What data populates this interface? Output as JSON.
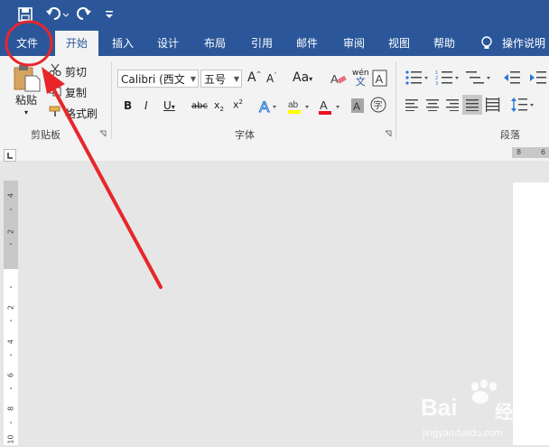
{
  "tabs": [
    "文件",
    "开始",
    "插入",
    "设计",
    "布局",
    "引用",
    "邮件",
    "审阅",
    "视图",
    "帮助"
  ],
  "tell_me": "操作说明",
  "clipboard": {
    "paste": "粘贴",
    "cut": "剪切",
    "copy": "复制",
    "format_painter": "格式刷",
    "group": "剪贴板"
  },
  "font": {
    "name": "Calibri (西文",
    "size": "五号",
    "group": "字体"
  },
  "paragraph": {
    "group": "段落"
  },
  "ruler": {
    "h_numbers": [
      "8",
      "6"
    ],
    "v_numbers": [
      "4",
      "2",
      "2",
      "4",
      "6",
      "8",
      "10"
    ]
  },
  "watermark": {
    "brand": "Bai",
    "brand2": "经验",
    "url": "jingyan.baidu.com"
  },
  "colors": {
    "accent": "#2b579a",
    "annotation": "#e8262a"
  }
}
